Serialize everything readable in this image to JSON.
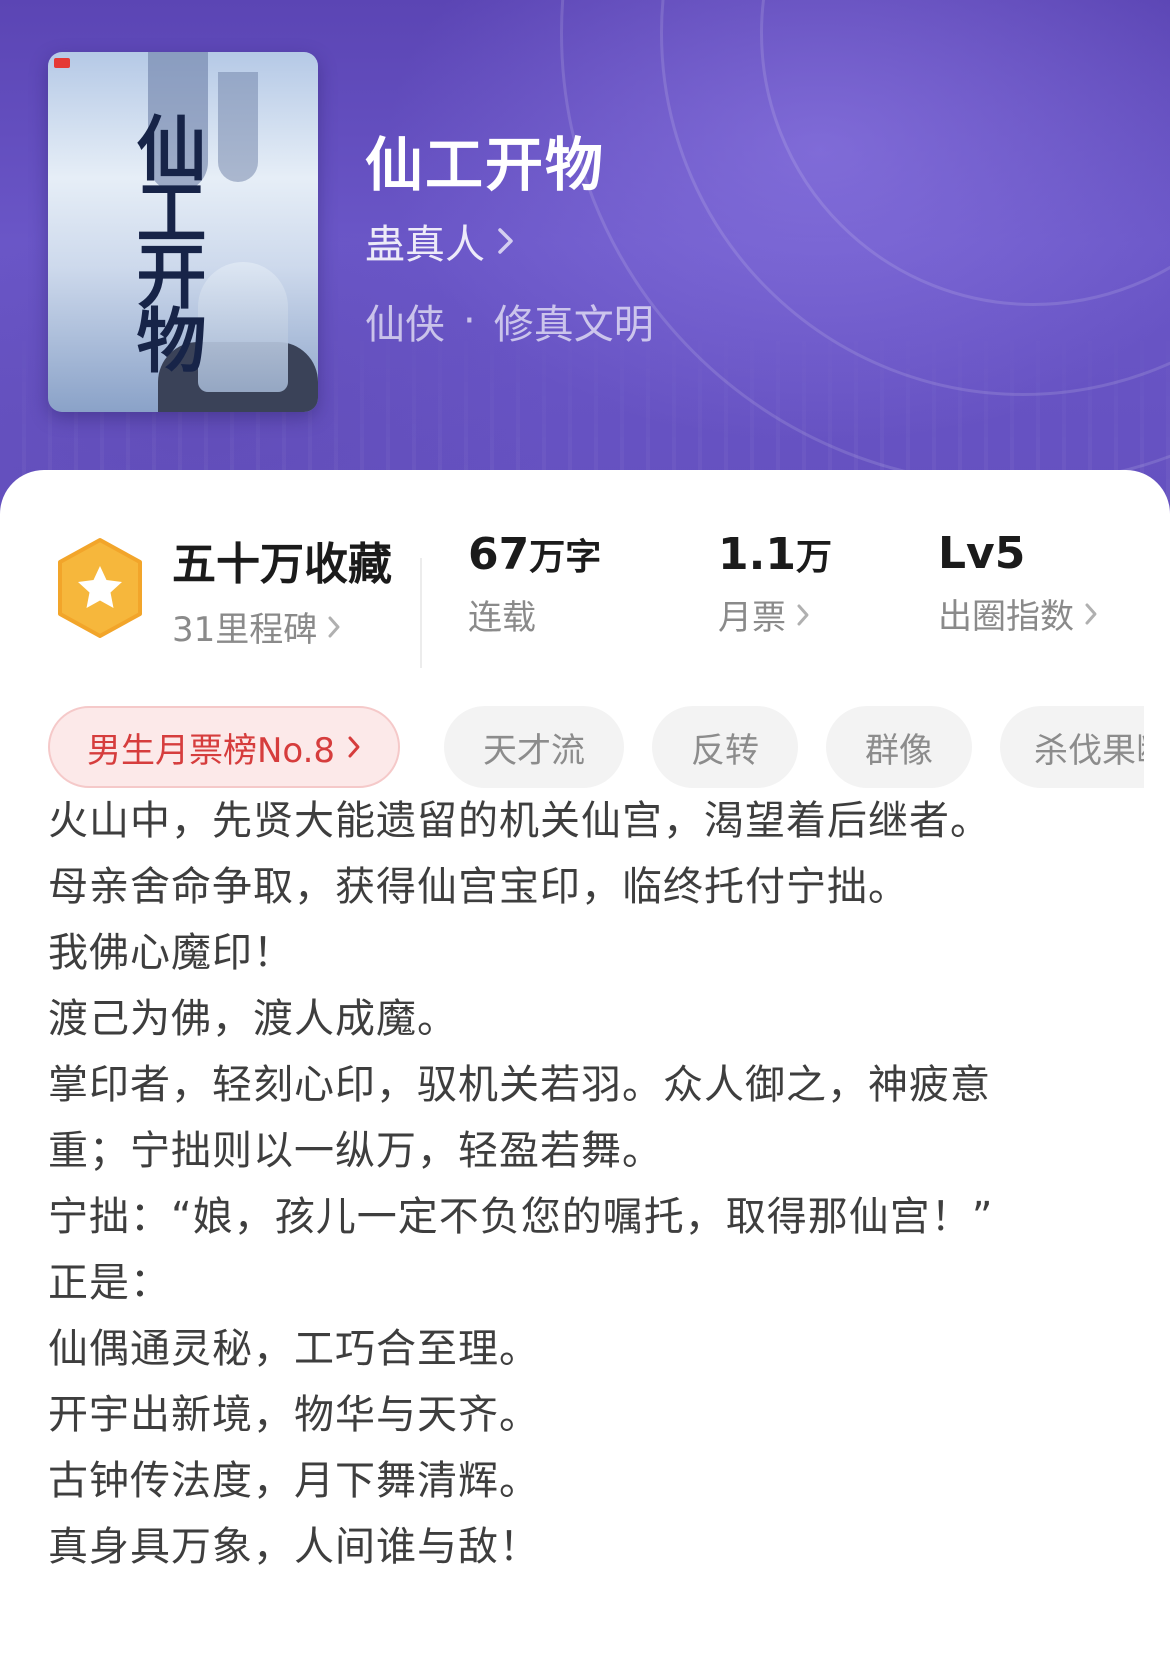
{
  "book": {
    "title": "仙工开物",
    "author": "蛊真人",
    "genre": "仙侠",
    "subgenre": "修真文明",
    "cover": {
      "title_art": "仙工开物"
    }
  },
  "stats": {
    "collect": {
      "value": "五十万收藏",
      "label": "31里程碑"
    },
    "words": {
      "value": "67",
      "unit": "万字",
      "label": "连载"
    },
    "tickets": {
      "value": "1.1",
      "unit": "万",
      "label": "月票"
    },
    "popularity": {
      "value": "Lv5",
      "label": "出圈指数"
    }
  },
  "tags": [
    {
      "label": "男生月票榜No.8"
    },
    {
      "label": "天才流"
    },
    {
      "label": "反转"
    },
    {
      "label": "群像"
    },
    {
      "label": "杀伐果断"
    }
  ],
  "description": [
    "火山中，先贤大能遗留的机关仙宫，渴望着后继者。",
    "母亲舍命争取，获得仙宫宝印，临终托付宁拙。",
    "我佛心魔印！",
    "渡己为佛，渡人成魔。",
    "掌印者，轻刻心印，驭机关若羽。众人御之，神疲意",
    "重；宁拙则以一纵万，轻盈若舞。",
    "宁拙：“娘，孩儿一定不负您的嘱托，取得那仙宫！”",
    "正是：",
    "仙偶通灵秘，工巧合至理。",
    "开宇出新境，物华与天齐。",
    "古钟传法度，月下舞清辉。",
    "真身具万象，人间谁与敌！"
  ],
  "colors": {
    "hero": "#6450bf",
    "rank_tag_text": "#d63d3d",
    "rank_tag_bg": "#fce9e9",
    "medal": "#f6b73c"
  }
}
